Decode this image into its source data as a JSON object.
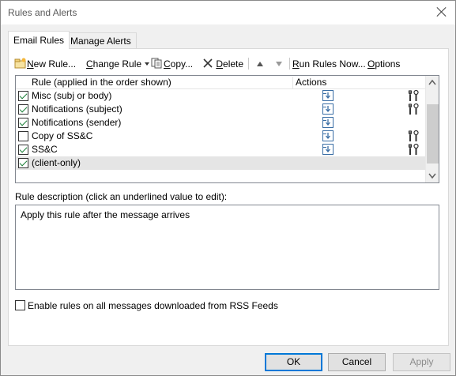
{
  "window": {
    "title": "Rules and Alerts"
  },
  "tabs": [
    {
      "label": "Email Rules",
      "active": true
    },
    {
      "label": "Manage Alerts",
      "active": false
    }
  ],
  "toolbar": {
    "new_rule": "New Rule...",
    "change_rule": "Change Rule",
    "copy": "Copy...",
    "delete": "Delete",
    "run_rules_now": "Run Rules Now...",
    "options": "Options"
  },
  "list": {
    "header_rule": "Rule (applied in the order shown)",
    "header_actions": "Actions",
    "rows": [
      {
        "name": "Misc (subj or body)",
        "checked": true,
        "action_icon": "move-to-folder-icon",
        "has_tool": true
      },
      {
        "name": "Notifications (subject)",
        "checked": true,
        "action_icon": "move-to-folder-icon",
        "has_tool": true
      },
      {
        "name": "Notifications (sender)",
        "checked": true,
        "action_icon": "move-to-folder-icon",
        "has_tool": false
      },
      {
        "name": "Copy of SS&C",
        "checked": false,
        "action_icon": "move-to-folder-icon",
        "has_tool": true
      },
      {
        "name": "SS&C",
        "checked": true,
        "action_icon": "move-to-folder-icon",
        "has_tool": true
      },
      {
        "name": "  (client-only)",
        "checked": true,
        "action_icon": "",
        "has_tool": false,
        "selected": true
      }
    ]
  },
  "description": {
    "label": "Rule description (click an underlined value to edit):",
    "text": "Apply this rule after the message arrives"
  },
  "rss": {
    "label": "Enable rules on all messages downloaded from RSS Feeds",
    "checked": false
  },
  "buttons": {
    "ok": "OK",
    "cancel": "Cancel",
    "apply": "Apply"
  },
  "colors": {
    "accent": "#0078d7",
    "check": "#1a7f37",
    "selected_row": "#e5e5e5"
  }
}
